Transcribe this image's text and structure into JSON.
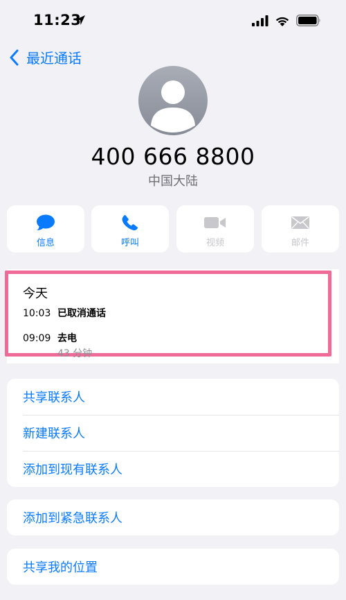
{
  "status_bar": {
    "time": "11:23"
  },
  "nav": {
    "back_label": "最近通话"
  },
  "contact": {
    "phone_number": "400 666 8800",
    "region": "中国大陆"
  },
  "actions": [
    {
      "label": "信息",
      "icon": "message-icon",
      "enabled": true
    },
    {
      "label": "呼叫",
      "icon": "phone-icon",
      "enabled": true
    },
    {
      "label": "视频",
      "icon": "video-icon",
      "enabled": false
    },
    {
      "label": "邮件",
      "icon": "mail-icon",
      "enabled": false
    }
  ],
  "recents": {
    "day": "今天",
    "calls": [
      {
        "time": "10:03",
        "desc": "已取消通话",
        "duration": ""
      },
      {
        "time": "09:09",
        "desc": "去电",
        "duration": "43 分钟"
      }
    ]
  },
  "menu_group_1": [
    "共享联系人",
    "新建联系人",
    "添加到现有联系人"
  ],
  "menu_group_2": [
    "添加到紧急联系人"
  ],
  "menu_group_3": [
    "共享我的位置"
  ],
  "colors": {
    "accent": "#0a7aff",
    "highlight": "#ef6a96",
    "background": "#f1f1f6",
    "disabled": "#c7c7cc"
  }
}
